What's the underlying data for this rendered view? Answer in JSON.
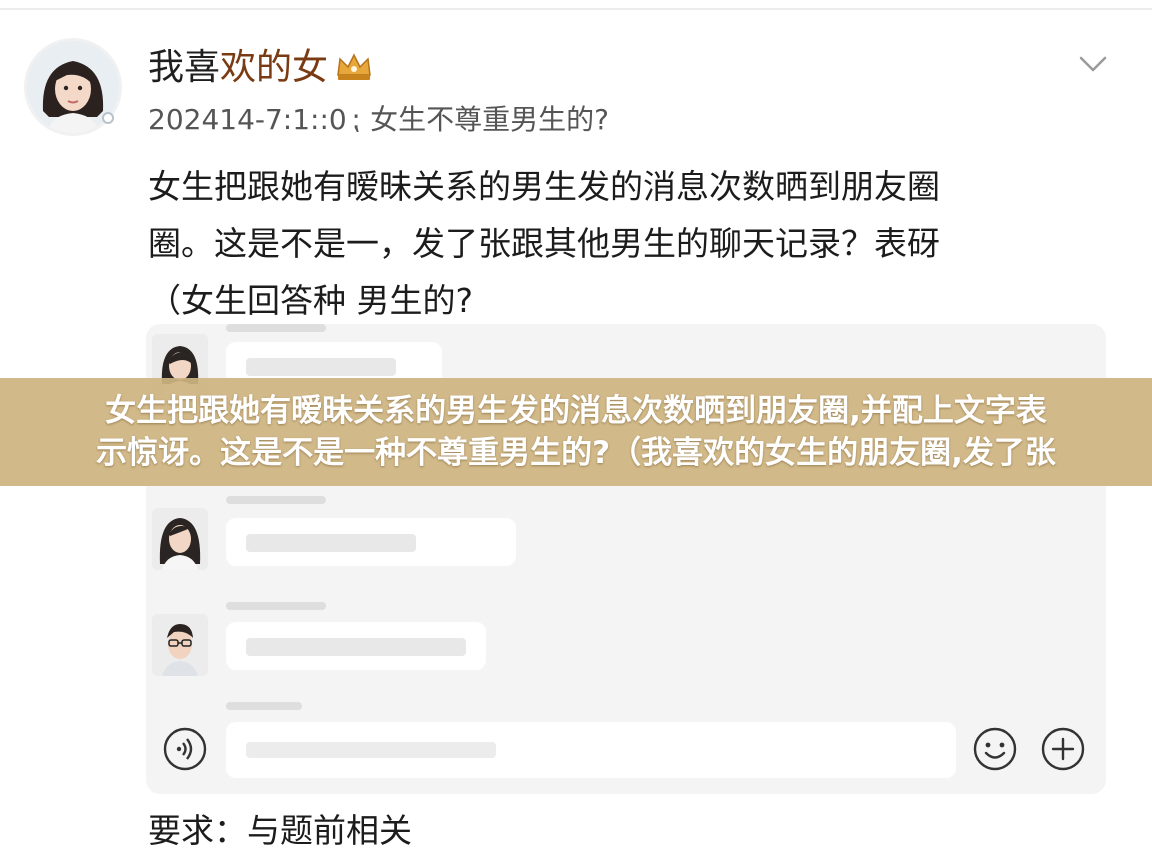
{
  "post": {
    "username_prefix": "我喜",
    "username_highlight": "欢的女",
    "badge_icon": "crown-icon",
    "timestamp": "202414-7:1::0",
    "separator": "⁏",
    "subtitle": "女生不尊重男生的?",
    "body_lines": [
      "女生把跟她有暧昧关系的男生发的消息次数晒到朋友圈",
      "圈。这是不是一，发了张跟其他男生的聊天记录？表砑",
      "（女生回答种 男生的?"
    ],
    "collapse_icon": "chevron-down-icon"
  },
  "banner": {
    "lines": [
      "女生把跟她有暧昧关系的男生发的消息次数晒到朋友圈,并配上文字表",
      "示惊讶。这是不是一种不尊重男生的?（我喜欢的女生的朋友圈,发了张"
    ]
  },
  "chat_input": {
    "voice_icon": "voice-icon",
    "emoji_icon": "emoji-icon",
    "plus_icon": "plus-icon"
  },
  "footer": {
    "note": "要求：与题前相关"
  },
  "colors": {
    "username_highlight": "#7a3a12",
    "banner": "#ceb480",
    "panel": "#f4f4f5"
  }
}
